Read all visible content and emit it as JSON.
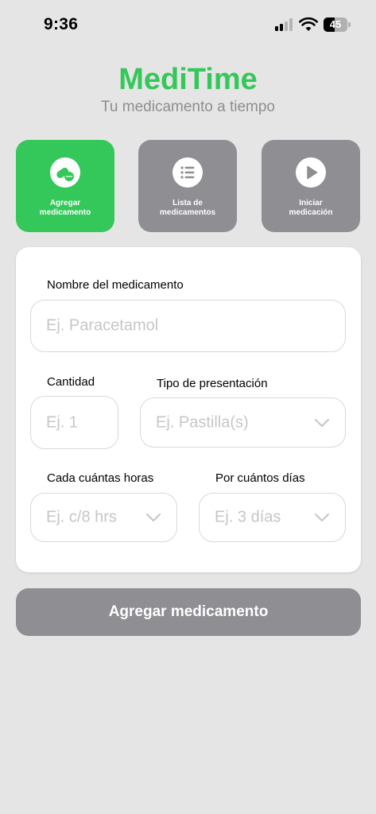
{
  "status_bar": {
    "time": "9:36",
    "battery": "45",
    "battery_level": 0.45
  },
  "header": {
    "title": "MediTime",
    "subtitle": "Tu medicamento a tiempo"
  },
  "tiles": [
    {
      "label_line1": "Agregar",
      "label_line2": "medicamento",
      "icon": "pills-icon",
      "active": true
    },
    {
      "label_line1": "Lista de",
      "label_line2": "medicamentos",
      "icon": "list-icon",
      "active": false
    },
    {
      "label_line1": "Iniciar",
      "label_line2": "medicación",
      "icon": "play-icon",
      "active": false
    }
  ],
  "form": {
    "name": {
      "label": "Nombre del medicamento",
      "placeholder": "Ej. Paracetamol",
      "value": ""
    },
    "quantity": {
      "label": "Cantidad",
      "placeholder": "Ej. 1",
      "value": ""
    },
    "presentation": {
      "label": "Tipo de presentación",
      "placeholder": "Ej. Pastilla(s)",
      "value": ""
    },
    "interval": {
      "label": "Cada cuántas horas",
      "placeholder": "Ej. c/8 hrs",
      "value": ""
    },
    "duration": {
      "label": "Por cuántos días",
      "placeholder": "Ej. 3 días",
      "value": ""
    }
  },
  "submit_label": "Agregar medicamento",
  "colors": {
    "accent": "#34c759",
    "inactive_tile": "#8e8e93",
    "background": "#e5e5e5",
    "placeholder": "#c6c6c8"
  }
}
